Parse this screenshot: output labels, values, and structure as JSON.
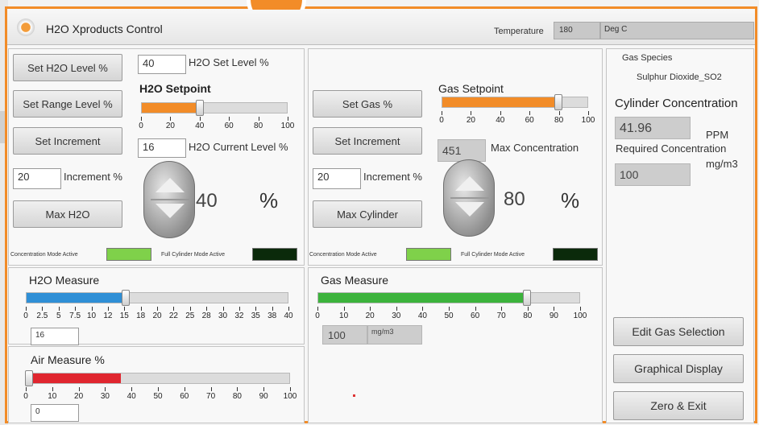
{
  "app": {
    "title": "H2O Xproducts Control",
    "accent": "#f28c28"
  },
  "header": {
    "temperature_label": "Temperature",
    "temperature_value": "180",
    "temperature_unit": "Deg C"
  },
  "h2o": {
    "set_level_button": "Set H2O Level %",
    "set_level_value": "40",
    "set_level_label": "H2O Set Level %",
    "setpoint_label": "H2O Setpoint",
    "setpoint_percent": 40,
    "set_range_button": "Set Range Level %",
    "set_increment_button": "Set Increment",
    "current_level_value": "16",
    "current_level_label": "H2O Current Level %",
    "increment_value": "20",
    "increment_label": "Increment %",
    "max_button": "Max H2O",
    "display_value": "40",
    "percent_symbol": "%",
    "concentration_mode": "Concentration Mode Active",
    "full_cylinder_mode": "Full Cylinder Mode Active",
    "ticks": [
      "0",
      "20",
      "40",
      "60",
      "80",
      "100"
    ]
  },
  "gas": {
    "set_gas_button": "Set Gas %",
    "setpoint_label": "Gas Setpoint",
    "setpoint_percent": 80,
    "set_increment_button": "Set Increment",
    "max_conc_value": "451",
    "max_conc_label": "Max Concentration",
    "increment_value": "20",
    "increment_label": "Increment %",
    "max_button": "Max Cylinder",
    "display_value": "80",
    "percent_symbol": "%",
    "concentration_mode": "Concentration Mode Active",
    "full_cylinder_mode": "Full Cylinder Mode Active",
    "ticks": [
      "0",
      "20",
      "40",
      "60",
      "80",
      "100"
    ]
  },
  "h2o_measure": {
    "label": "H2O Measure",
    "value_percent": 38,
    "ticks": [
      "0",
      "2.5",
      "5",
      "7.5",
      "10",
      "12",
      "15",
      "18",
      "20",
      "22",
      "25",
      "28",
      "30",
      "32",
      "35",
      "38",
      "40"
    ],
    "field_value": "16"
  },
  "air_measure": {
    "label": "Air Measure %",
    "value_percent": 36,
    "ticks": [
      "0",
      "10",
      "20",
      "30",
      "40",
      "50",
      "60",
      "70",
      "80",
      "90",
      "100"
    ],
    "field_value": "0"
  },
  "gas_measure": {
    "label": "Gas Measure",
    "value_percent": 80,
    "ticks": [
      "0",
      "10",
      "20",
      "30",
      "40",
      "50",
      "60",
      "70",
      "80",
      "90",
      "100"
    ],
    "field_value": "100",
    "field_unit": "mg/m3"
  },
  "species": {
    "header": "Gas Species",
    "name": "Sulphur Dioxide_SO2",
    "cylinder_label": "Cylinder Concentration",
    "cylinder_value": "41.96",
    "cylinder_unit": "PPM",
    "required_label": "Required Concentration",
    "required_unit": "mg/m3",
    "required_value": "100"
  },
  "actions": {
    "edit_gas": "Edit Gas Selection",
    "graphical": "Graphical Display",
    "zero_exit": "Zero & Exit"
  },
  "colors": {
    "orange": "#f28c28",
    "blue": "#2f8fd6",
    "green": "#3cb33c",
    "red": "#e0262f",
    "led_green": "#7fd14a",
    "led_dark": "#0b2a0b"
  }
}
